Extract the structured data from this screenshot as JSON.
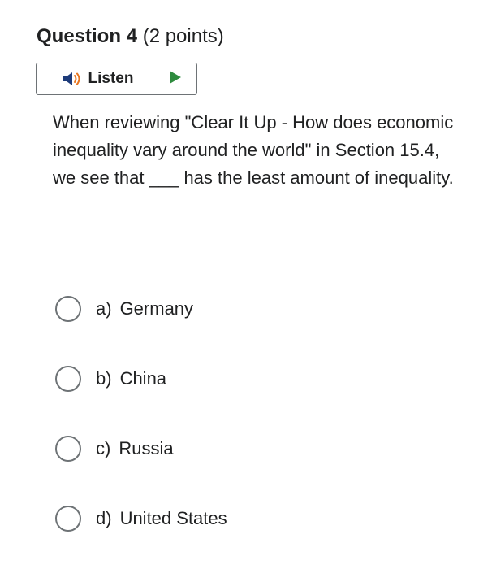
{
  "question": {
    "title": "Question 4",
    "points": "(2 points)",
    "text": "When reviewing \"Clear It Up - How does economic inequality vary around the world\" in Section 15.4, we see that ___ has the least amount of inequality."
  },
  "listen": {
    "label": "Listen",
    "speaker_icon": "speaker-icon",
    "play_icon": "play-icon",
    "speaker_color": "#1d3b7a",
    "speaker_accent": "#e87722",
    "play_color": "#2e8b3e"
  },
  "options": [
    {
      "letter": "a)",
      "text": "Germany"
    },
    {
      "letter": "b)",
      "text": "China"
    },
    {
      "letter": "c)",
      "text": "Russia"
    },
    {
      "letter": "d)",
      "text": "United States"
    }
  ]
}
